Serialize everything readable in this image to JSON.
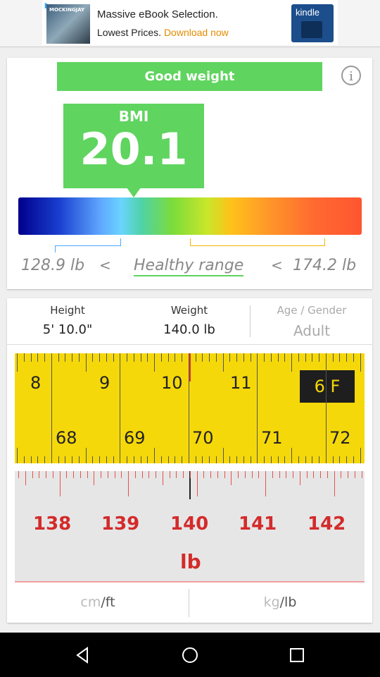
{
  "ad": {
    "line1": "Massive eBook Selection.",
    "line2_prefix": "Lowest Prices. ",
    "line2_link": "Download now",
    "thumb_text": "MOCKINGJAY",
    "brand": "kindle"
  },
  "bmi": {
    "status": "Good weight",
    "label": "BMI",
    "value": "20.1",
    "range_low": "128.9 lb",
    "range_lt1": "<",
    "healthy_label": "Healthy range",
    "range_lt2": "<",
    "range_high": "174.2 lb"
  },
  "stats": {
    "height_label": "Height",
    "height_value": "5' 10.0\"",
    "weight_label": "Weight",
    "weight_value": "140.0 lb",
    "age_label": "Age / Gender",
    "age_value": "Adult"
  },
  "height_ruler": {
    "feet": [
      "8",
      "9",
      "10",
      "11"
    ],
    "inches": [
      "68",
      "69",
      "70",
      "71",
      "72"
    ],
    "badge": "6 F"
  },
  "weight_ruler": {
    "values": [
      "138",
      "139",
      "140",
      "141",
      "142"
    ],
    "unit": "lb"
  },
  "units": {
    "left_dim": "cm",
    "left_active": "/ft",
    "right_dim": "kg",
    "right_active": "/lb"
  }
}
